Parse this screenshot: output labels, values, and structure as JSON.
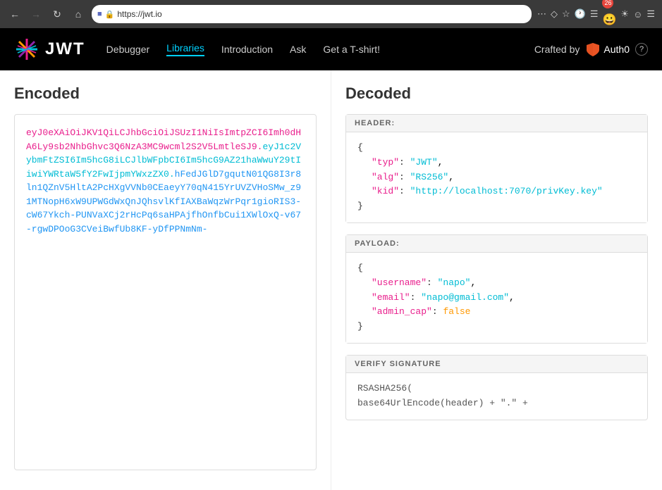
{
  "browser": {
    "url": "https://jwt.io",
    "back_disabled": false,
    "forward_disabled": true
  },
  "header": {
    "logo_text": "JWT",
    "nav": {
      "debugger": "Debugger",
      "libraries": "Libraries",
      "introduction": "Introduction",
      "ask": "Ask",
      "tshirt": "Get a T-shirt!"
    },
    "crafted_by": "Crafted by",
    "auth0_text": "Auth0"
  },
  "encoded": {
    "title": "Encoded",
    "part1": "eyJ0eXAiOiJKV1QiLCJhbGciOiJSUzI1NiIsImtpZCI6Imh0dHA6Ly9sb2NhbGhvc3Q6NzA3MC9wcml2S2V5LmtleSJ9",
    "part2": "eyJ1c2VybmFtZSI6Im5hcG8iLCJlbWFpbCI6Im5hcG9AZ21haWwuY29tIiwiYWRtaW5fY2FwIjpmYWxzZX0",
    "part3": "hFedJGlD7gqutN01QG8I3r8ln1QZnV5HltA2PcHXgVVNb0CEaeyY70qN415YrUVZVHoSMw_z91MTNopH6xW9UPWGdWxQnJQhsvlKfIAXBaWqzWrPqr1gioRIS3-cW67Ykch-PUNVaXCj2rHcPq6saHPAjfhOnfbCui1XWlOxQ-v67-rgwDPOoG3CVeiBwfUb8KF-yDfPPNmNm-"
  },
  "decoded": {
    "title": "Decoded",
    "header_label": "HEADER:",
    "header_content": {
      "typ": "\"JWT\"",
      "alg": "\"RS256\"",
      "kid": "\"http://localhost:7070/privKey.key\""
    },
    "payload_label": "PAYLOAD:",
    "payload_content": {
      "username": "\"napo\"",
      "email": "\"napo@gmail.com\"",
      "admin_cap": "false"
    },
    "verify_label": "VERIFY SIGNATURE",
    "verify_line1": "RSASHA256(",
    "verify_line2": "base64UrlEncode(header) + \".\" +"
  }
}
